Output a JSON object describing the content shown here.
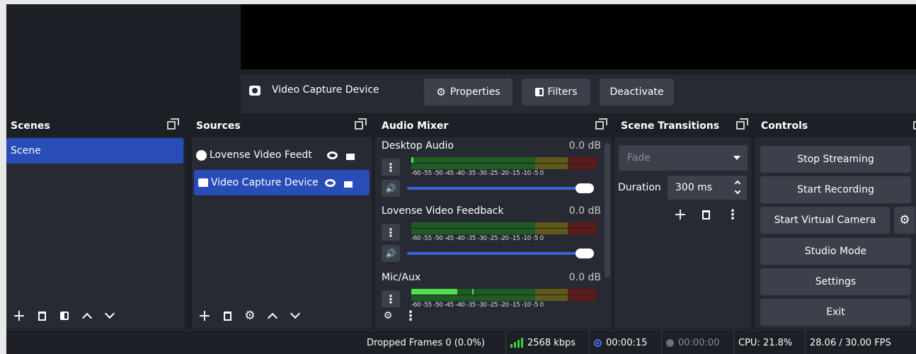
{
  "source_bar": {
    "selected_source": "Video Capture Device",
    "properties_label": "Properties",
    "filters_label": "Filters",
    "deactivate_label": "Deactivate"
  },
  "docks": {
    "scenes": {
      "title": "Scenes",
      "items": [
        "Scene"
      ]
    },
    "sources": {
      "title": "Sources",
      "items": [
        "Lovense Video Feedt",
        "Video Capture Device"
      ]
    },
    "audio_mixer": {
      "title": "Audio Mixer",
      "channels": [
        {
          "name": "Desktop Audio",
          "db": "0.0 dB",
          "volume": 1.0,
          "level": 0.0
        },
        {
          "name": "Lovense Video Feedback",
          "db": "0.0 dB",
          "volume": 1.0,
          "level": 0.0
        },
        {
          "name": "Mic/Aux",
          "db": "0.0 dB",
          "volume": 1.0,
          "level": 0.25
        }
      ],
      "ticks": "-60 -55 -50 -45 -40 -35 -30 -25 -20 -15 -10 -5 0"
    },
    "scene_transitions": {
      "title": "Scene Transitions",
      "transition": "Fade",
      "duration_label": "Duration",
      "duration_value": "300 ms"
    },
    "controls": {
      "title": "Controls",
      "buttons": [
        "Stop Streaming",
        "Start Recording",
        "Start Virtual Camera",
        "Studio Mode",
        "Settings",
        "Exit"
      ]
    }
  },
  "status_bar": {
    "dropped_frames": "Dropped Frames 0 (0.0%)",
    "bitrate": "2568 kbps",
    "stream_time": "00:00:15",
    "record_time": "00:00:00",
    "cpu": "CPU: 21.8%",
    "fps": "28.06 / 30.00 FPS"
  },
  "colors": {
    "accent": "#284cb8",
    "background": "#272a33",
    "button": "#3c404b"
  }
}
